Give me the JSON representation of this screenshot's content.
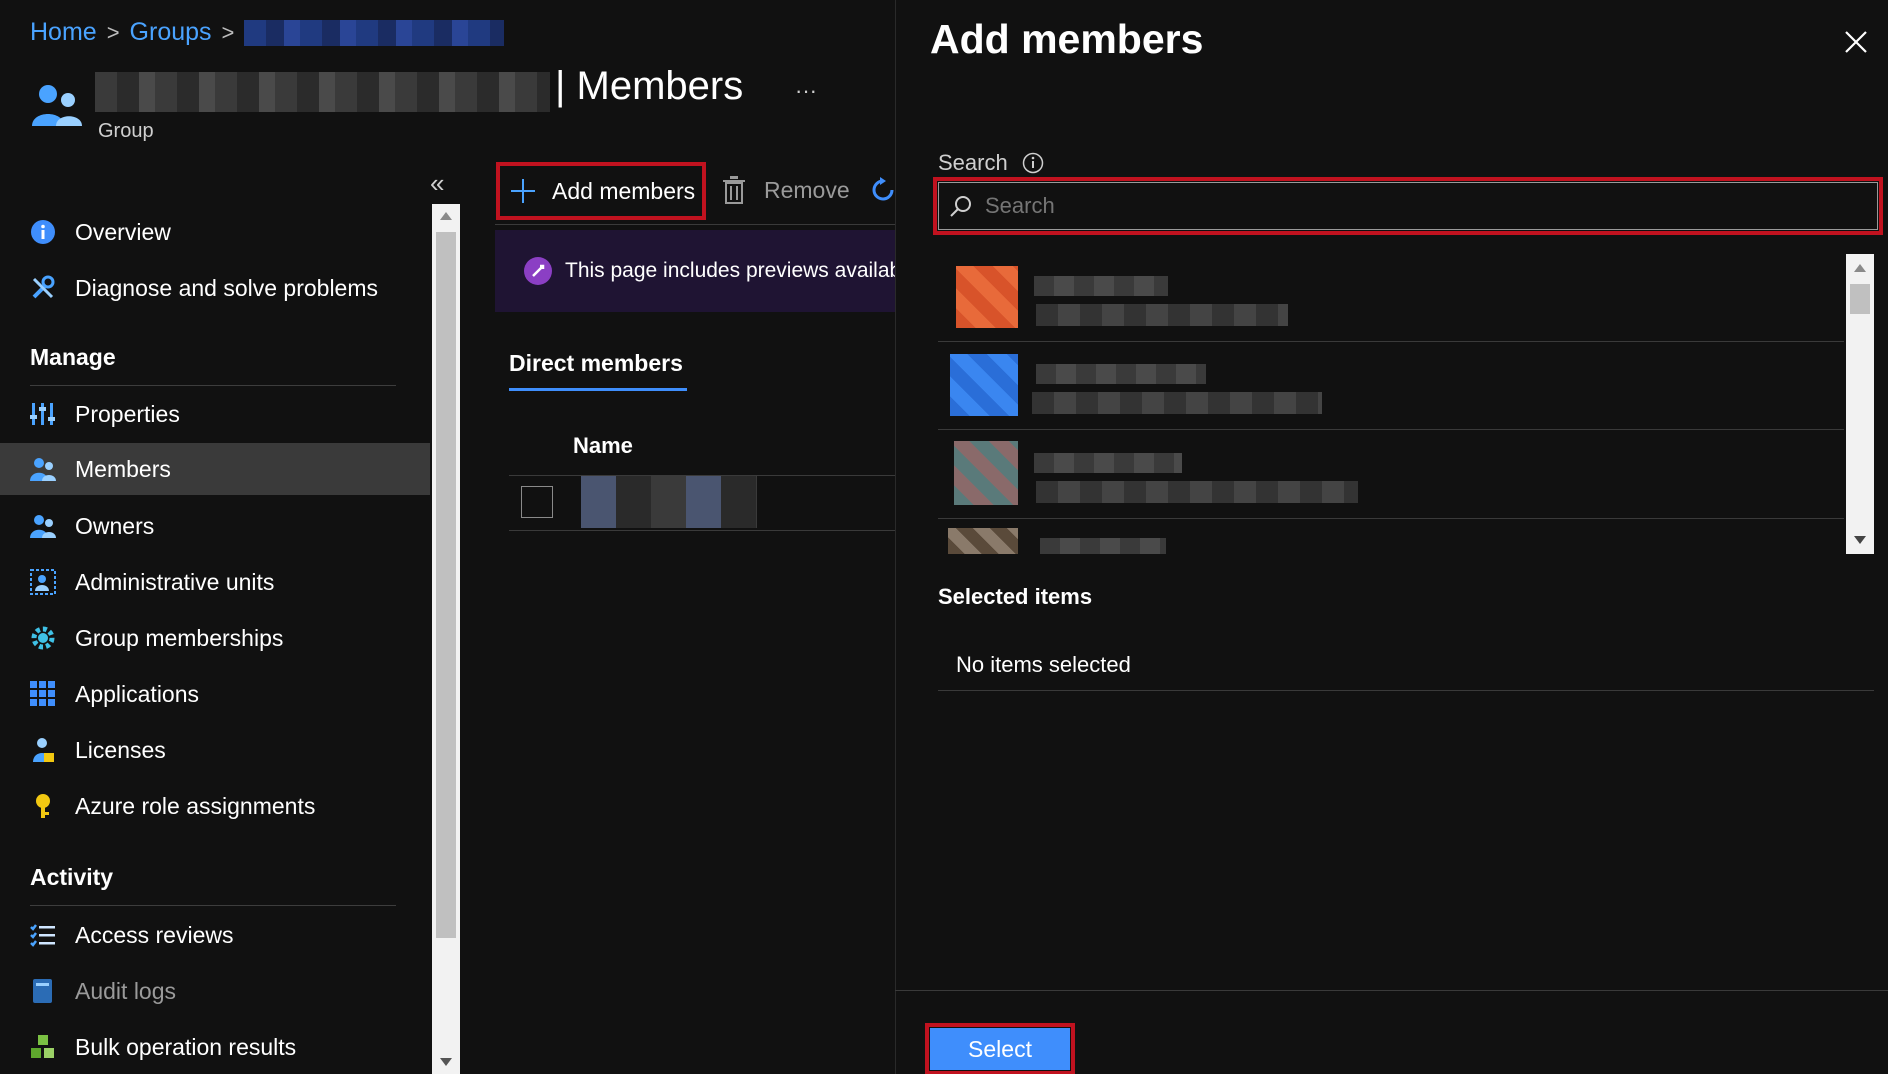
{
  "breadcrumb": {
    "home": "Home",
    "groups": "Groups",
    "sep": ">"
  },
  "header": {
    "title": "| Members",
    "subtitle": "Group",
    "more": "···"
  },
  "sidebar": {
    "collapse": "«",
    "items_top": [
      {
        "label": "Overview",
        "icon": "info-icon"
      },
      {
        "label": "Diagnose and solve problems",
        "icon": "wrench-icon"
      }
    ],
    "manage_heading": "Manage",
    "manage": [
      {
        "label": "Properties",
        "icon": "properties-icon"
      },
      {
        "label": "Members",
        "icon": "members-icon",
        "active": true
      },
      {
        "label": "Owners",
        "icon": "owners-icon"
      },
      {
        "label": "Administrative units",
        "icon": "admin-units-icon"
      },
      {
        "label": "Group memberships",
        "icon": "gear-icon"
      },
      {
        "label": "Applications",
        "icon": "grid-icon"
      },
      {
        "label": "Licenses",
        "icon": "license-icon"
      },
      {
        "label": "Azure role assignments",
        "icon": "key-icon"
      }
    ],
    "activity_heading": "Activity",
    "activity": [
      {
        "label": "Access reviews",
        "icon": "checklist-icon"
      },
      {
        "label": "Audit logs",
        "icon": "book-icon"
      },
      {
        "label": "Bulk operation results",
        "icon": "cubes-icon"
      }
    ]
  },
  "toolbar": {
    "add_members": "Add members",
    "remove": "Remove"
  },
  "banner": {
    "text": "This page includes previews availab"
  },
  "tabs": {
    "direct_members": "Direct members"
  },
  "table": {
    "name_header": "Name"
  },
  "panel": {
    "title": "Add members",
    "search_label": "Search",
    "search_placeholder": "Search",
    "selected_heading": "Selected items",
    "no_items": "No items selected",
    "select_button": "Select"
  },
  "colors": {
    "accent": "#3f8efc",
    "highlight": "#c1121f",
    "link": "#4aa3ff"
  }
}
